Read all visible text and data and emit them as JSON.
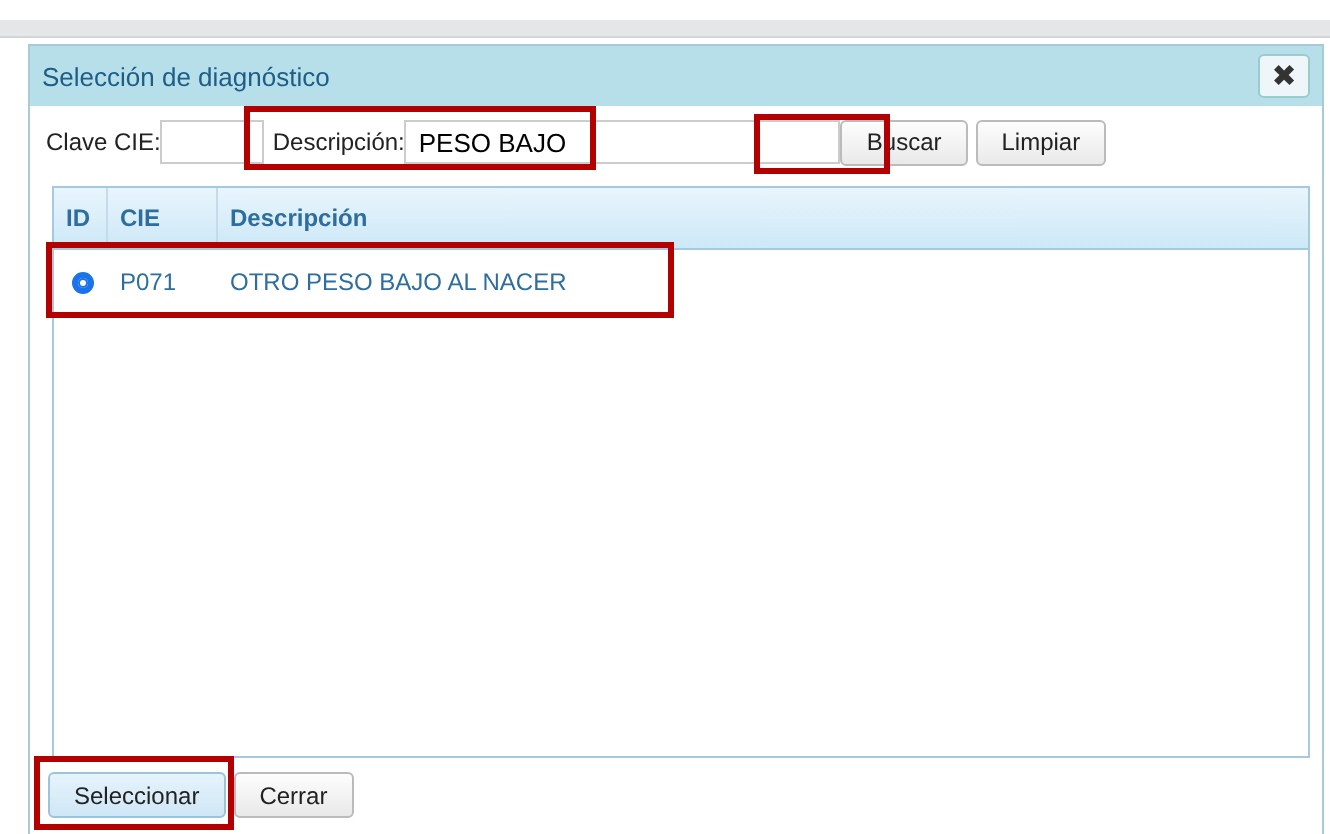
{
  "window": {
    "title": "Selección de diagnóstico",
    "close_label": "✖"
  },
  "filters": [
    {
      "kind": "code",
      "label": "Clave CIE:"
    },
    {
      "kind": "description",
      "label": "Descripción:",
      "value": "PESO BAJO",
      "highlighted": true
    }
  ],
  "search_buttons": [
    {
      "label": "Buscar",
      "highlighted": true
    },
    {
      "label": "Limpiar"
    }
  ],
  "table": {
    "columns": [
      "ID",
      "CIE",
      "Descripción"
    ],
    "rows": [
      {
        "selected": true,
        "highlighted": true,
        "code": "P071",
        "description": "OTRO PESO BAJO AL NACER"
      }
    ]
  },
  "buttons": [
    {
      "label": "Seleccionar",
      "primary": true,
      "highlighted": true
    },
    {
      "label": "Cerrar",
      "primary": false
    }
  ]
}
